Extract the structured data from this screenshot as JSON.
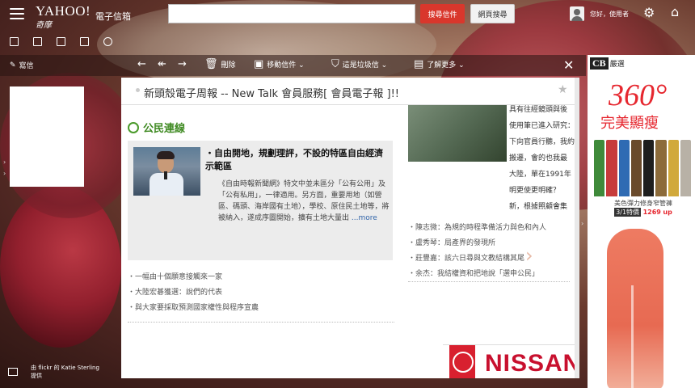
{
  "header": {
    "logo_main": "YAHOO!",
    "logo_sub": "奇摩",
    "product": "電子信箱",
    "search_placeholder": "",
    "search_mail_label": "搜尋信件",
    "search_web_label": "網頁搜尋",
    "greeting": "您好，使用者"
  },
  "toolbar": {
    "compose": "寫信",
    "delete": "刪除",
    "move": "移動信件 ⌄",
    "spam": "這是垃圾信 ⌄",
    "more": "了解更多 ⌄"
  },
  "message": {
    "subject": "新頭殼電子周報 -- New Talk 會員服務[ 會員電子報 ]!!",
    "section_title": "公民連線",
    "article": {
      "headline": "・自由開地，規劃理評，不設的特區自由經濟示範區",
      "body": "《自由時報新聞網》特文中並未區分「公有公用」及「公有私用」，一律適用。另方面，重要用地（如營區、碼頭、海岸國有土地），學校、原住民土地等，將被納入，遂成序圖開始，擴有土地大量出",
      "more": "...more"
    },
    "left_list": [
      "一幅由十個願意接觸來一家",
      "大陸宏碁獲選：說們的代表",
      "與大家要採取預測國家權性與程序宣農"
    ],
    "right_text_lines": [
      "具有往經鏡頭與後",
      "使用筆已進入研究：",
      "下向官員行聽，我約",
      "搬遷，會的也我最",
      "大陸，單在1991年",
      "明更使更明確？",
      "新，根據照顧會集"
    ],
    "right_list": [
      "陳志微：為規的時程準備活力與色和內人",
      "盧秀琴：局產界的發現所",
      "莊豐嘉：該六日尋與文教結構其尾",
      "余杰：我結權資和把地說「選申公民」"
    ],
    "ad_brand": "NISSAN"
  },
  "ad": {
    "brand_box": "CB",
    "brand_sub": "嚴選",
    "big_number": "360°",
    "headline": "完美顯瘦",
    "caption_line1": "美色彈力修身窄管褲",
    "price_label": "3/1特價",
    "price": "1269",
    "price_unit": "up"
  },
  "credits": {
    "line1": "由 flickr 的 Katie Sterling",
    "line2": "提供"
  },
  "colors": {
    "accent_red": "#d9372c",
    "section_green": "#3f8a22",
    "nissan_red": "#c8102e"
  }
}
